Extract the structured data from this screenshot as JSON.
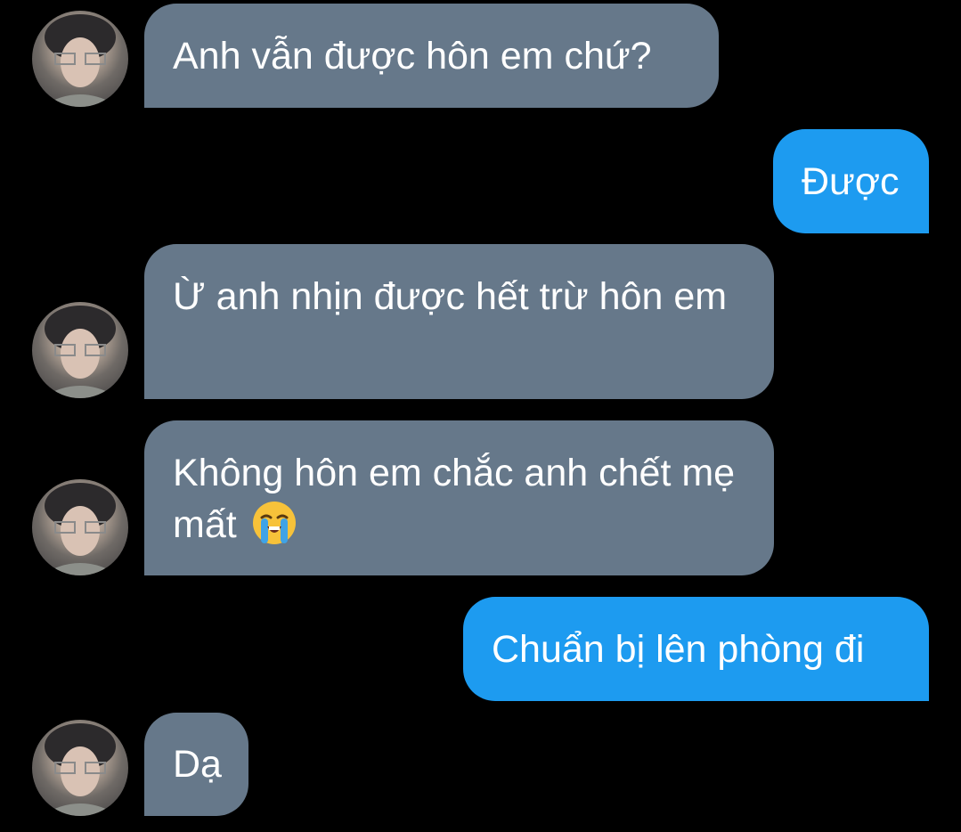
{
  "colors": {
    "background": "#000000",
    "incoming_bubble": "#66788a",
    "outgoing_bubble": "#1d9bf0",
    "text": "#ffffff"
  },
  "messages": [
    {
      "side": "incoming",
      "text": "Anh vẫn được hôn em chứ?",
      "avatar": "profile-photo"
    },
    {
      "side": "outgoing",
      "text": "Được"
    },
    {
      "side": "incoming",
      "text": "Ừ anh nhịn được hết trừ hôn em",
      "avatar": "profile-photo"
    },
    {
      "side": "incoming",
      "text": "Không hôn em chắc anh chết mẹ mất",
      "emoji": "loudly-crying-face",
      "avatar": "profile-photo"
    },
    {
      "side": "outgoing",
      "text": "Chuẩn bị lên phòng đi"
    },
    {
      "side": "incoming",
      "text": "Dạ",
      "avatar": "profile-photo"
    }
  ]
}
